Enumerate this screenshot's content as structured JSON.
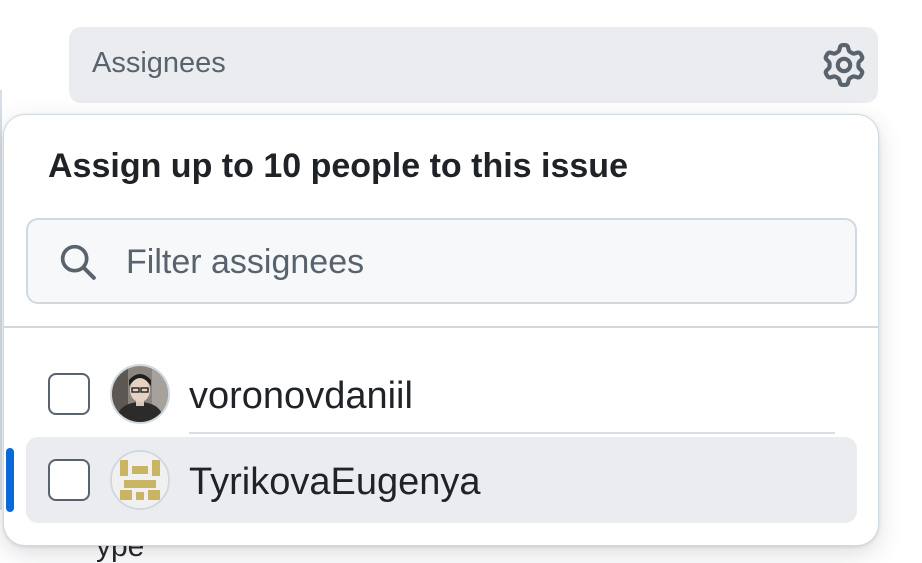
{
  "sidebar_section": {
    "title": "Assignees",
    "gear_icon": "gear-icon"
  },
  "popover": {
    "title": "Assign up to 10 people to this issue",
    "filter": {
      "placeholder": "Filter assignees",
      "value": "",
      "icon": "search-icon"
    },
    "people": [
      {
        "username": "voronovdaniil",
        "checked": false,
        "selected": false
      },
      {
        "username": "TyrikovaEugenya",
        "checked": false,
        "selected": true
      }
    ]
  },
  "colors": {
    "accent": "#0969da",
    "muted_text": "#59636e",
    "header_bg": "#eaecef",
    "identicon": "#c8b462"
  }
}
